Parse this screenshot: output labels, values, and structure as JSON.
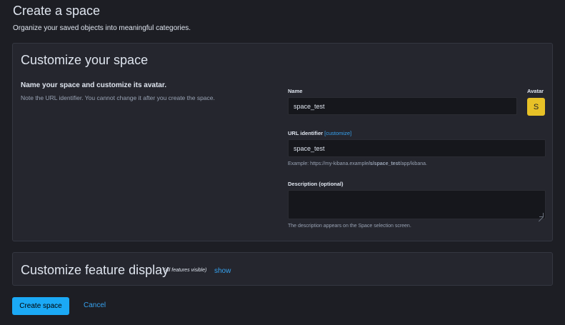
{
  "page": {
    "title": "Create a space",
    "subtitle": "Organize your saved objects into meaningful categories."
  },
  "customize": {
    "title": "Customize your space",
    "desc_title": "Name your space and customize its avatar.",
    "desc_text": "Note the URL identifier. You cannot change it after you create the space.",
    "name_label": "Name",
    "name_value": "space_test",
    "avatar_label": "Avatar",
    "avatar_initial": "S",
    "url_label": "URL identifier",
    "url_customize": "[customize]",
    "url_value": "space_test",
    "url_example_prefix": "Example: https://my-kibana.example",
    "url_example_bold": "/s/space_test",
    "url_example_suffix": "/app/kibana.",
    "description_label": "Description (optional)",
    "description_value": "",
    "description_helper": "The description appears on the Space selection screen."
  },
  "features": {
    "title": "Customize feature display",
    "note": "(all features visible)",
    "show_link": "show"
  },
  "actions": {
    "create_label": "Create space",
    "cancel_label": "Cancel"
  },
  "colors": {
    "background": "#1d1e24",
    "panel": "#25262e",
    "accent": "#1ba9f5",
    "link": "#36a2ef",
    "avatar": "#e7c127"
  }
}
